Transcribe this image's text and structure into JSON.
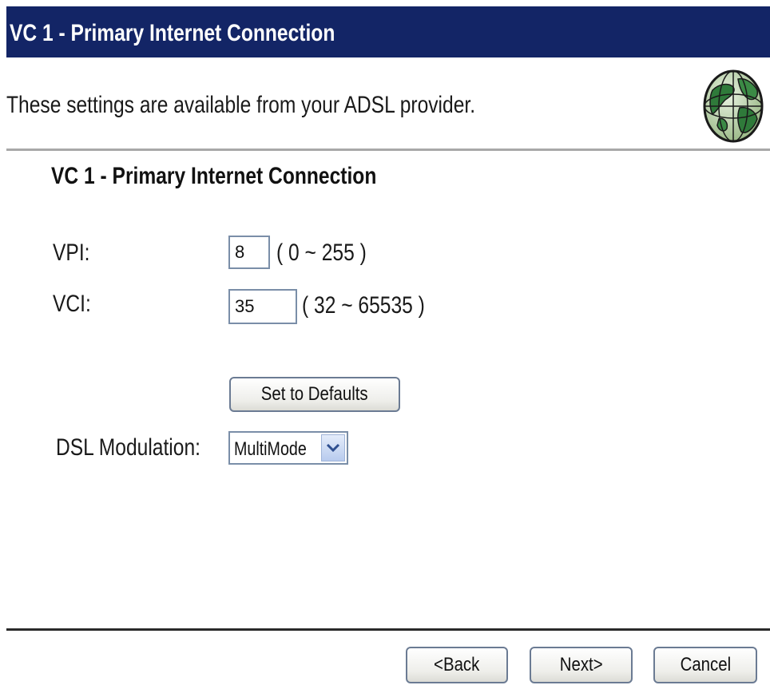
{
  "header": {
    "title": "VC 1 - Primary Internet Connection",
    "description": "These settings are available from your ADSL provider.",
    "icon": "globe-icon"
  },
  "section": {
    "heading": "VC 1 - Primary Internet Connection"
  },
  "vpi": {
    "label": "VPI:",
    "value": "8",
    "range": "( 0 ~ 255 )"
  },
  "vci": {
    "label": "VCI:",
    "value": "35",
    "range": "( 32 ~ 65535 )"
  },
  "defaults_button": {
    "label": "Set to Defaults"
  },
  "modulation": {
    "label": "DSL Modulation:",
    "selected": "MultiMode",
    "icon": "chevron-down-icon"
  },
  "footer": {
    "back_label": "<Back",
    "next_label": "Next>",
    "cancel_label": "Cancel"
  },
  "colors": {
    "title_bar": "#132566",
    "title_text": "#ffffff",
    "input_border": "#7a8ea8"
  }
}
